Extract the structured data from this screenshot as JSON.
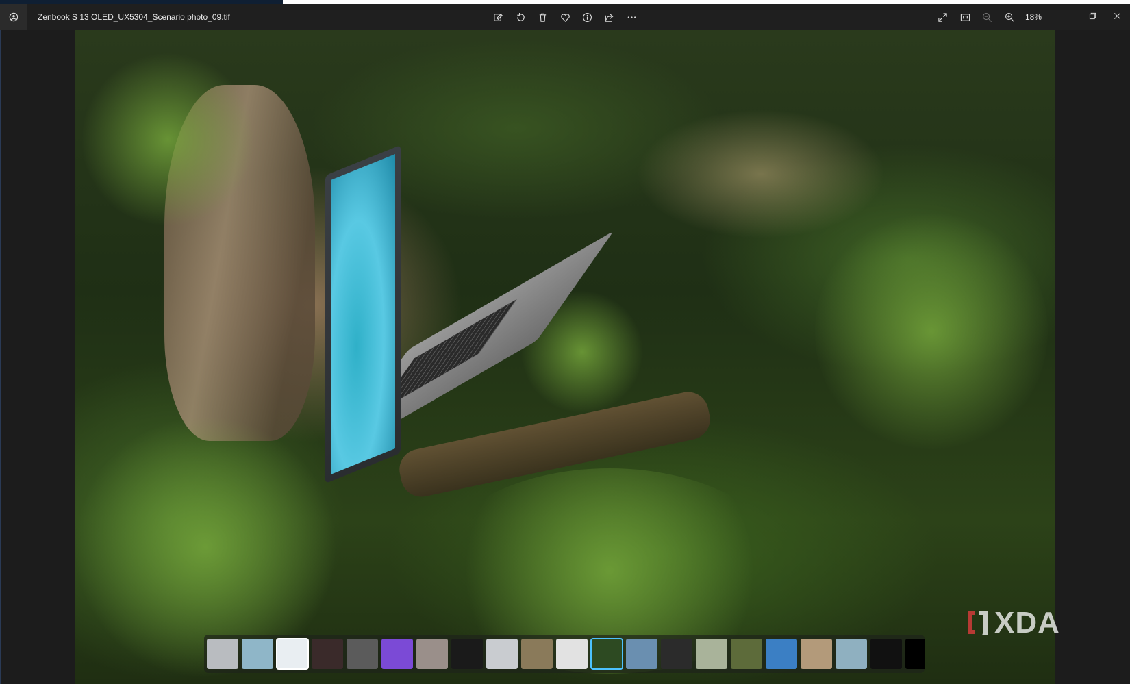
{
  "window": {
    "title": "Zenbook S 13 OLED_UX5304_Scenario photo_09.tif",
    "zoom_level": "18%"
  },
  "toolbar": {
    "center_tools": [
      {
        "name": "edit-image-icon"
      },
      {
        "name": "rotate-icon"
      },
      {
        "name": "delete-icon"
      },
      {
        "name": "favorite-icon"
      },
      {
        "name": "info-icon"
      },
      {
        "name": "share-icon"
      },
      {
        "name": "more-icon"
      }
    ],
    "right_tools": [
      {
        "name": "fullscreen-icon"
      },
      {
        "name": "actual-size-icon"
      },
      {
        "name": "zoom-out-icon"
      },
      {
        "name": "zoom-in-icon"
      }
    ]
  },
  "window_controls": [
    {
      "name": "minimize-icon"
    },
    {
      "name": "restore-icon"
    },
    {
      "name": "close-icon"
    }
  ],
  "watermark": {
    "text": "XDA"
  },
  "filmstrip": {
    "thumbnails": [
      {
        "color": "#b9bcc0"
      },
      {
        "color": "#8fb6c8"
      },
      {
        "color": "#e9eef2",
        "state": "current"
      },
      {
        "color": "#3a2a2a"
      },
      {
        "color": "#5b5b5b"
      },
      {
        "color": "#7b4ad6"
      },
      {
        "color": "#9a8f8a"
      },
      {
        "color": "#1a1a1a"
      },
      {
        "color": "#c9ccd0"
      },
      {
        "color": "#8a7a5a"
      },
      {
        "color": "#e2e2e2"
      },
      {
        "color": "#2d4a22",
        "state": "selected"
      },
      {
        "color": "#6a8fb0"
      },
      {
        "color": "#2b2b2b"
      },
      {
        "color": "#a9b39a"
      },
      {
        "color": "#5d6b3a"
      },
      {
        "color": "#3b7fc4"
      },
      {
        "color": "#b39a7a"
      },
      {
        "color": "#8fb0c0"
      },
      {
        "color": "#111111"
      },
      {
        "color": "#000000"
      }
    ]
  }
}
